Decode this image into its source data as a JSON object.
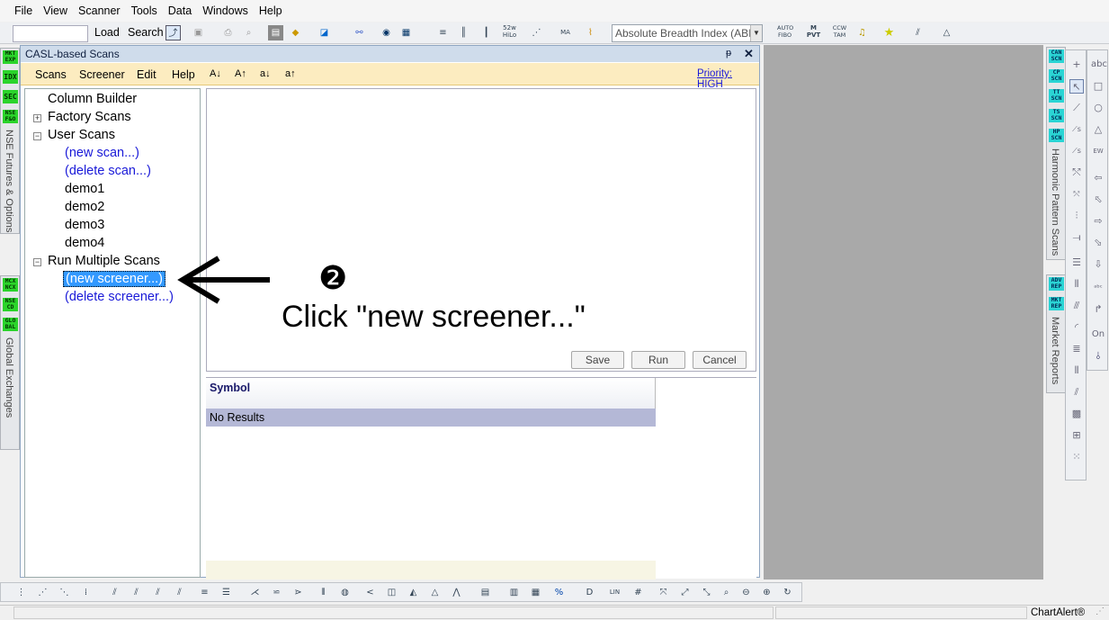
{
  "menubar": [
    "File",
    "View",
    "Scanner",
    "Tools",
    "Data",
    "Windows",
    "Help"
  ],
  "toolbar": {
    "load": "Load",
    "search": "Search",
    "indicator_combo": "Absolute Breadth Index (ABI",
    "icon_labels": [
      "52w HiLo",
      "AUTO FIBO",
      "M PVT",
      "CCW TAM",
      "TAS",
      "MA"
    ]
  },
  "left_tabs": {
    "top": {
      "badges": [
        "MKT EXP",
        "IDX",
        "SEC",
        "NSE F&O"
      ],
      "label": "NSE Futures & Options"
    },
    "bottom": {
      "badges": [
        "MCX NCX",
        "NSE CD",
        "GLO BAL"
      ],
      "label": "Global Exchanges"
    }
  },
  "right_tabs": {
    "top": {
      "badges": [
        "CAN SCN",
        "CP SCN",
        "TT SCN",
        "TS SCN",
        "HP SCN"
      ],
      "label": "Harmonic Pattern Scans"
    },
    "bottom": {
      "badges": [
        "ADV REP",
        "MKT REP"
      ],
      "label": "Market Reports"
    }
  },
  "panel": {
    "title": "CASL-based Scans",
    "pin": "ᵽ",
    "close": "✕",
    "menu": [
      "Scans",
      "Screener",
      "Edit",
      "Help"
    ],
    "sort_buttons": [
      "A↓",
      "A↑",
      "a↓",
      "a↑"
    ],
    "priority": "Priority: HIGH"
  },
  "tree": {
    "column_builder": "Column Builder",
    "factory_scans": "Factory Scans",
    "user_scans": "User Scans",
    "new_scan": "(new scan...)",
    "delete_scan": "(delete scan...)",
    "demos": [
      "demo1",
      "demo2",
      "demo3",
      "demo4"
    ],
    "run_multiple": "Run Multiple Scans",
    "new_screener": "(new screener...)",
    "delete_screener": "(delete screener...)"
  },
  "editor": {
    "save": "Save",
    "run": "Run",
    "cancel": "Cancel"
  },
  "results": {
    "header": "Symbol",
    "empty": "No Results"
  },
  "annotation": {
    "number": "❷",
    "text": "Click \"new screener...\""
  },
  "drawbar": {
    "abc": "abc",
    "on": "On"
  },
  "status": {
    "brand": "ChartAlert®"
  }
}
